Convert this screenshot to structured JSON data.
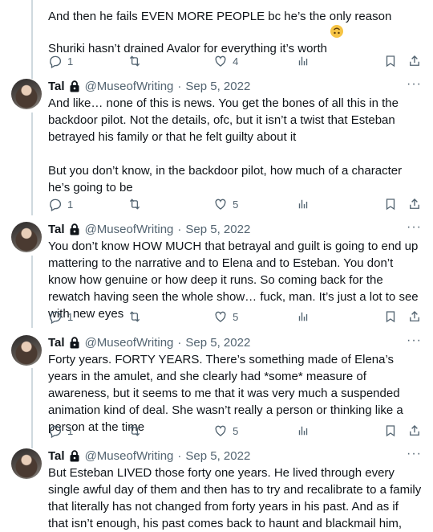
{
  "top_tweet": {
    "text": "And then he fails EVEN MORE PEOPLE bc he’s the only reason Shuriki hasn’t drained Avalor for everything it’s worth",
    "emoji": "upside-down-face",
    "replies": "1",
    "likes": "4"
  },
  "tweets": [
    {
      "name": "Tal",
      "handle": "@MuseofWriting",
      "date": "Sep 5, 2022",
      "text": "And like… none of this is news. You get the bones of all this in the backdoor pilot. Not the details, ofc, but it isn’t a twist that Esteban betrayed his family or that he felt guilty about it\n\nBut you don’t know, in the backdoor pilot, how much of a character he’s going to be",
      "replies": "1",
      "likes": "5"
    },
    {
      "name": "Tal",
      "handle": "@MuseofWriting",
      "date": "Sep 5, 2022",
      "text": "You don’t know HOW MUCH that betrayal and guilt is going to end up mattering to the narrative and to Elena and to Esteban. You don’t know how genuine or how deep it runs. So coming back for the rewatch having seen the whole show… fuck, man. It’s just a lot to see with new eyes",
      "replies": "1",
      "likes": "5"
    },
    {
      "name": "Tal",
      "handle": "@MuseofWriting",
      "date": "Sep 5, 2022",
      "text": "Forty years. FORTY YEARS. There’s something made of Elena’s years in the amulet, and she clearly had *some* measure of awareness, but it seems to me that it was very much a suspended animation kind of deal. She wasn’t really a person or thinking like a person at the time",
      "replies": "1",
      "likes": "5"
    },
    {
      "name": "Tal",
      "handle": "@MuseofWriting",
      "date": "Sep 5, 2022",
      "text": "But Esteban LIVED those forty one years. He lived through every single awful day of them and then has to try and recalibrate to a family that literally has not changed from forty years in his past. And as if that isn’t enough, his past comes back to haunt and blackmail him,",
      "replies": "",
      "likes": ""
    }
  ],
  "separator": "·",
  "more_label": "···"
}
